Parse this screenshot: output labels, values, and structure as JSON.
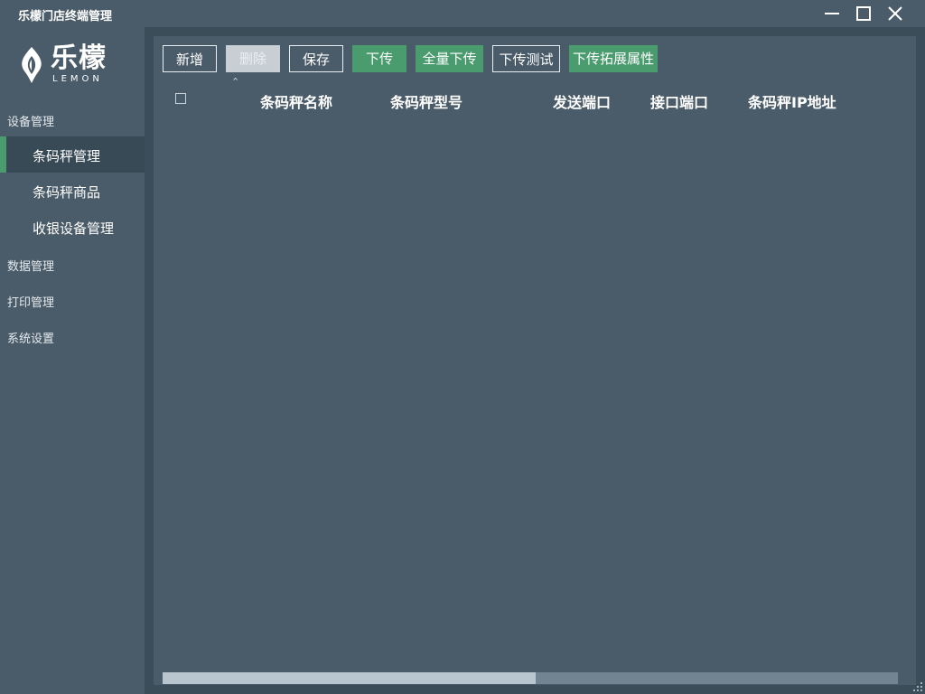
{
  "window": {
    "title": "乐檬门店终端管理"
  },
  "logo": {
    "brand": "乐檬",
    "sub": "LEMON"
  },
  "sidebar": {
    "sections": [
      {
        "label": "设备管理"
      },
      {
        "label": "数据管理"
      },
      {
        "label": "打印管理"
      },
      {
        "label": "系统设置"
      }
    ],
    "items": [
      {
        "label": "条码秤管理",
        "active": true
      },
      {
        "label": "条码秤商品",
        "active": false
      },
      {
        "label": "收银设备管理",
        "active": false
      }
    ]
  },
  "toolbar": {
    "add": "新增",
    "delete": "删除",
    "save": "保存",
    "download": "下传",
    "download_all": "全量下传",
    "download_test": "下传测试",
    "download_ext": "下传拓展属性"
  },
  "table": {
    "columns": [
      "条码秤名称",
      "条码秤型号",
      "发送端口",
      "接口端口",
      "条码秤IP地址"
    ],
    "rows": []
  },
  "scrollbar": {
    "horizontal_position": 0
  },
  "colors": {
    "bg": "#4a5b69",
    "accent_green": "#4a9c6f",
    "active_nav": "#394a57"
  }
}
